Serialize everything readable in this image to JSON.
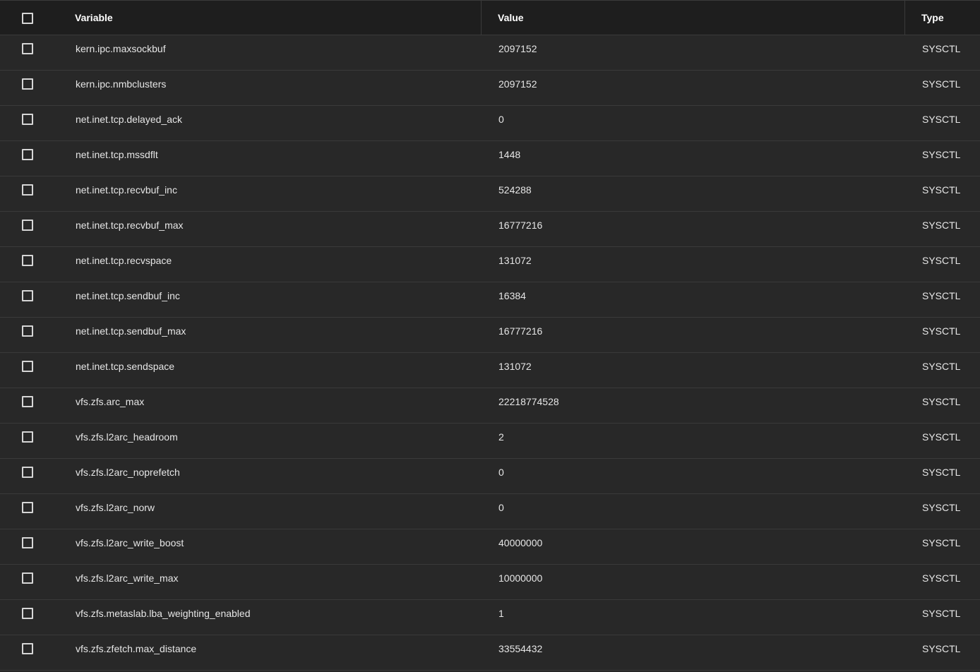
{
  "header": {
    "variable": "Variable",
    "value": "Value",
    "type": "Type"
  },
  "rows": [
    {
      "variable": "kern.ipc.maxsockbuf",
      "value": "2097152",
      "type": "SYSCTL"
    },
    {
      "variable": "kern.ipc.nmbclusters",
      "value": "2097152",
      "type": "SYSCTL"
    },
    {
      "variable": "net.inet.tcp.delayed_ack",
      "value": "0",
      "type": "SYSCTL"
    },
    {
      "variable": "net.inet.tcp.mssdflt",
      "value": "1448",
      "type": "SYSCTL"
    },
    {
      "variable": "net.inet.tcp.recvbuf_inc",
      "value": "524288",
      "type": "SYSCTL"
    },
    {
      "variable": "net.inet.tcp.recvbuf_max",
      "value": "16777216",
      "type": "SYSCTL"
    },
    {
      "variable": "net.inet.tcp.recvspace",
      "value": "131072",
      "type": "SYSCTL"
    },
    {
      "variable": "net.inet.tcp.sendbuf_inc",
      "value": "16384",
      "type": "SYSCTL"
    },
    {
      "variable": "net.inet.tcp.sendbuf_max",
      "value": "16777216",
      "type": "SYSCTL"
    },
    {
      "variable": "net.inet.tcp.sendspace",
      "value": "131072",
      "type": "SYSCTL"
    },
    {
      "variable": "vfs.zfs.arc_max",
      "value": "22218774528",
      "type": "SYSCTL"
    },
    {
      "variable": "vfs.zfs.l2arc_headroom",
      "value": "2",
      "type": "SYSCTL"
    },
    {
      "variable": "vfs.zfs.l2arc_noprefetch",
      "value": "0",
      "type": "SYSCTL"
    },
    {
      "variable": "vfs.zfs.l2arc_norw",
      "value": "0",
      "type": "SYSCTL"
    },
    {
      "variable": "vfs.zfs.l2arc_write_boost",
      "value": "40000000",
      "type": "SYSCTL"
    },
    {
      "variable": "vfs.zfs.l2arc_write_max",
      "value": "10000000",
      "type": "SYSCTL"
    },
    {
      "variable": "vfs.zfs.metaslab.lba_weighting_enabled",
      "value": "1",
      "type": "SYSCTL"
    },
    {
      "variable": "vfs.zfs.zfetch.max_distance",
      "value": "33554432",
      "type": "SYSCTL"
    }
  ]
}
